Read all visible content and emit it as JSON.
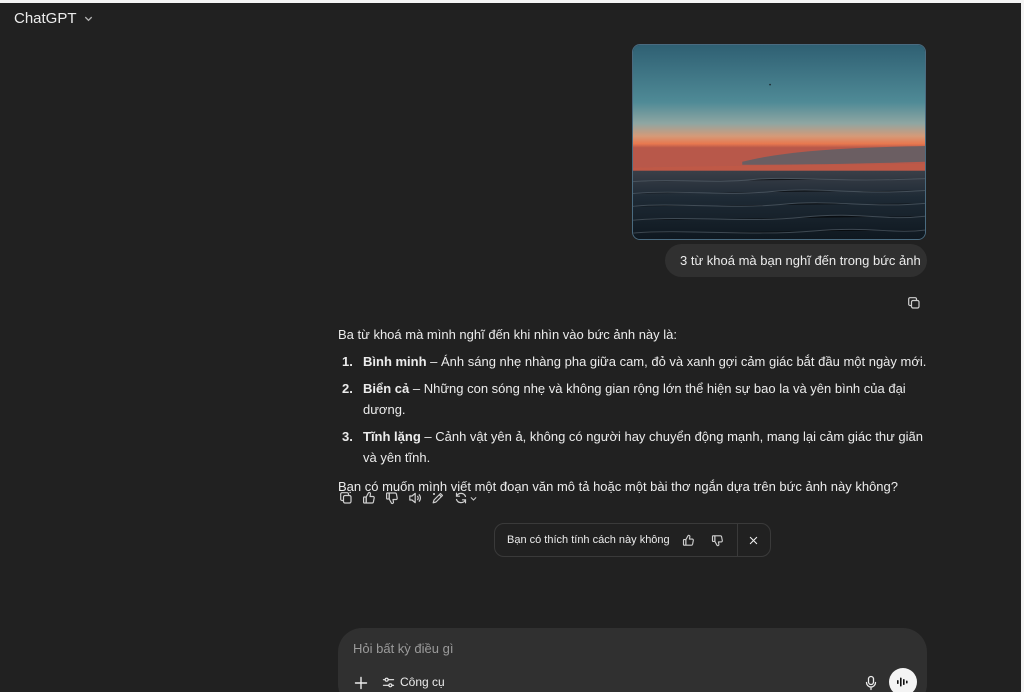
{
  "header": {
    "model_name": "ChatGPT"
  },
  "conversation": {
    "user_message": {
      "image_alt": "sunset over the sea",
      "text": "3 từ khoá mà bạn nghĩ đến trong bức ảnh"
    },
    "assistant_message": {
      "intro": "Ba từ khoá mà mình nghĩ đến khi nhìn vào bức ảnh này là:",
      "items": [
        {
          "num": "1.",
          "keyword": "Bình minh",
          "desc": " – Ánh sáng nhẹ nhàng pha giữa cam, đỏ và xanh gợi cảm giác bắt đầu một ngày mới."
        },
        {
          "num": "2.",
          "keyword": "Biển cả",
          "desc": " – Những con sóng nhẹ và không gian rộng lớn thể hiện sự bao la và yên bình của đại dương."
        },
        {
          "num": "3.",
          "keyword": "Tĩnh lặng",
          "desc": " – Cảnh vật yên ả, không có người hay chuyển động mạnh, mang lại cảm giác thư giãn và yên tĩnh."
        }
      ],
      "outro": "Bạn có muốn mình viết một đoạn văn mô tả hoặc một bài thơ ngắn dựa trên bức ảnh này không?"
    }
  },
  "feedback": {
    "question": "Bạn có thích tính cách này không"
  },
  "composer": {
    "placeholder": "Hỏi bất kỳ điều gì",
    "tools_label": "Công cụ"
  },
  "colors": {
    "background": "#212121",
    "surface": "#303030",
    "text": "#ececec",
    "muted": "#9b9b9b"
  }
}
